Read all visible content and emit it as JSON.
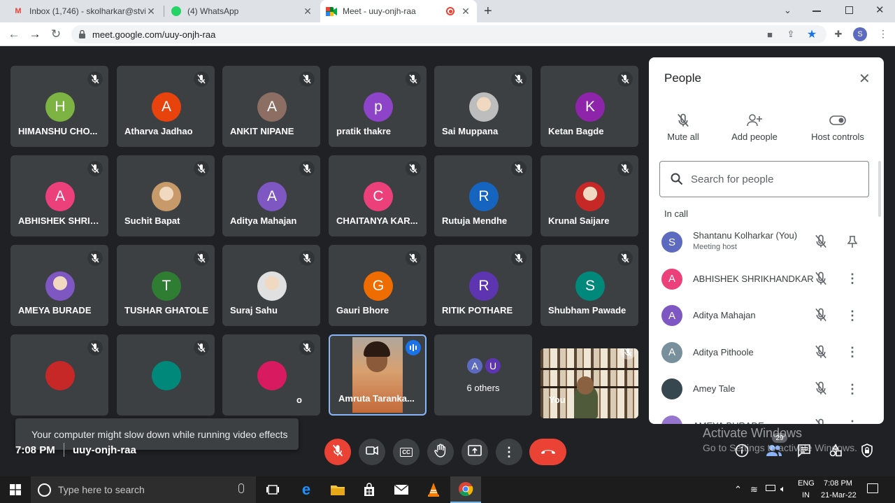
{
  "browser": {
    "tabs": [
      {
        "label": "Inbox (1,746) - skolharkar@stvin",
        "icon": "gmail-icon"
      },
      {
        "label": "(4) WhatsApp",
        "icon": "whatsapp-icon"
      },
      {
        "label": "Meet - uuy-onjh-raa",
        "icon": "meet-icon",
        "active": true
      }
    ],
    "url": "meet.google.com/uuy-onjh-raa"
  },
  "tiles": [
    {
      "name": "HIMANSHU CHO...",
      "initial": "H",
      "color": "#7cb342"
    },
    {
      "name": "Atharva Jadhao",
      "initial": "A",
      "color": "#e8430c"
    },
    {
      "name": "ANKIT NIPANE",
      "initial": "A",
      "color": "#8d6e63"
    },
    {
      "name": "pratik thakre",
      "initial": "p",
      "color": "#8e44c9"
    },
    {
      "name": "Sai Muppana",
      "initial": "",
      "color": "#bdbdbd",
      "photo": true
    },
    {
      "name": "Ketan Bagde",
      "initial": "K",
      "color": "#8e24aa"
    },
    {
      "name": "ABHISHEK SHRIK...",
      "initial": "A",
      "color": "#ec407a"
    },
    {
      "name": "Suchit Bapat",
      "initial": "",
      "color": "#c89a6a",
      "photo": true
    },
    {
      "name": "Aditya Mahajan",
      "initial": "A",
      "color": "#7e57c2"
    },
    {
      "name": "CHAITANYA KAR...",
      "initial": "C",
      "color": "#ec407a"
    },
    {
      "name": "Rutuja Mendhe",
      "initial": "R",
      "color": "#1565c0"
    },
    {
      "name": "Krunal Saijare",
      "initial": "",
      "color": "#c62828",
      "photo": true
    },
    {
      "name": "AMEYA BURADE",
      "initial": "",
      "color": "#7e57c2",
      "photo": true
    },
    {
      "name": "TUSHAR GHATOLE",
      "initial": "T",
      "color": "#2e7d32"
    },
    {
      "name": "Suraj Sahu",
      "initial": "",
      "color": "#e0e0e0",
      "photo": true
    },
    {
      "name": "Gauri Bhore",
      "initial": "G",
      "color": "#ef6c00"
    },
    {
      "name": "RITIK POTHARE",
      "initial": "R",
      "color": "#5e35b1"
    },
    {
      "name": "Shubham Pawade",
      "initial": "S",
      "color": "#00897b"
    }
  ],
  "bottom_tiles": {
    "presenter_name": "Amruta Taranka...",
    "others_label": "6 others",
    "others_initials": [
      "A",
      "U"
    ],
    "self_label": "You",
    "partial_c": "o"
  },
  "toast": "Your computer might slow down while running video effects",
  "meeting": {
    "time": "7:08 PM",
    "code": "uuy-onjh-raa"
  },
  "people_panel": {
    "title": "People",
    "actions": [
      "Mute all",
      "Add people",
      "Host controls"
    ],
    "search_placeholder": "Search for people",
    "section": "In call",
    "participants": [
      {
        "name": "Shantanu Kolharkar (You)",
        "sub": "Meeting host",
        "initial": "S",
        "color": "#5c6bc0"
      },
      {
        "name": "ABHISHEK SHRIKHANDKAR",
        "initial": "A",
        "color": "#ec407a"
      },
      {
        "name": "Aditya Mahajan",
        "initial": "A",
        "color": "#7e57c2"
      },
      {
        "name": "Aditya Pithoole",
        "initial": "A",
        "color": "#78909c"
      },
      {
        "name": "Amey Tale",
        "initial": "",
        "color": "#37474f"
      },
      {
        "name": "AMEYA BURADE",
        "initial": "",
        "color": "#9575cd"
      }
    ]
  },
  "participant_count": "29",
  "watermark": {
    "line1": "Activate Windows",
    "line2": "Go to Settings to activate Windows."
  },
  "taskbar": {
    "search_placeholder": "Type here to search",
    "lang": "ENG",
    "region": "IN",
    "time": "7:08 PM",
    "date": "21-Mar-22"
  }
}
